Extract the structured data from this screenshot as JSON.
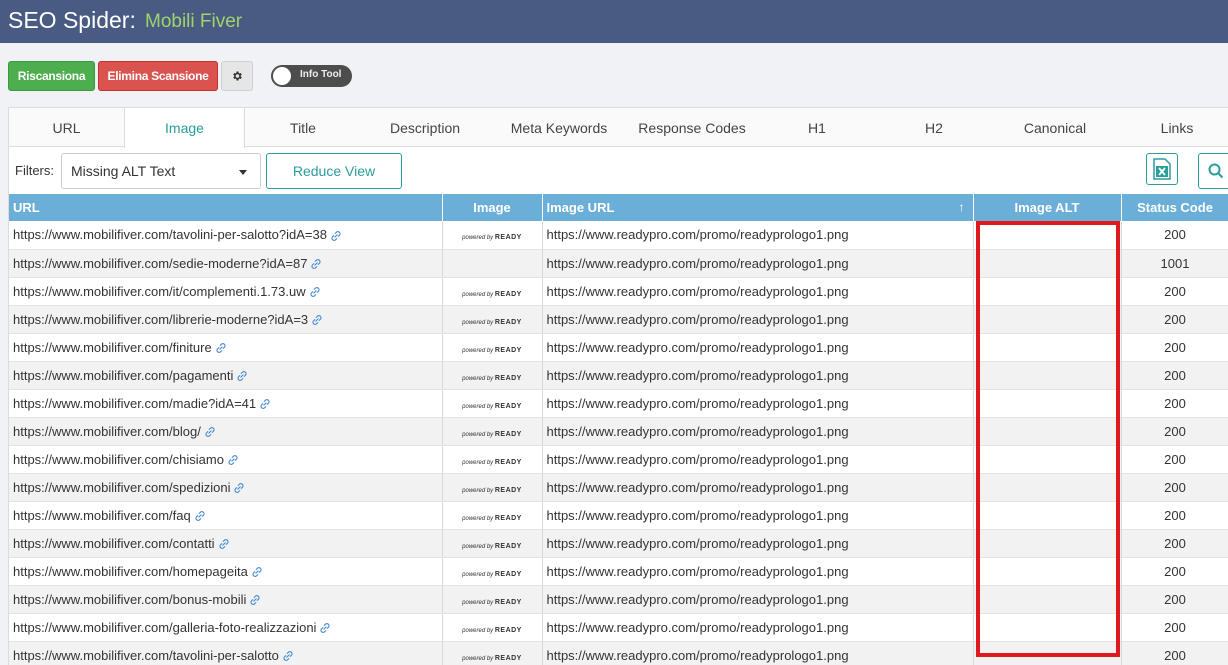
{
  "header": {
    "app_title": "SEO Spider:",
    "site_name": "Mobili Fiver"
  },
  "toolbar": {
    "rescan_label": "Riscansiona",
    "delete_label": "Elimina Scansione",
    "info_tool_label": "Info Tool"
  },
  "tabs": [
    {
      "label": "URL"
    },
    {
      "label": "Image"
    },
    {
      "label": "Title"
    },
    {
      "label": "Description"
    },
    {
      "label": "Meta Keywords"
    },
    {
      "label": "Response Codes"
    },
    {
      "label": "H1"
    },
    {
      "label": "H2"
    },
    {
      "label": "Canonical"
    },
    {
      "label": "Links"
    }
  ],
  "active_tab": "Image",
  "filters": {
    "label": "Filters:",
    "selected": "Missing ALT Text",
    "reduce_label": "Reduce View"
  },
  "table": {
    "headers": {
      "url": "URL",
      "image": "Image",
      "image_url": "Image URL",
      "image_alt": "Image ALT",
      "status": "Status Code"
    },
    "logo_text": {
      "small": "powered by",
      "brand": "READY"
    },
    "rows": [
      {
        "url": "https://www.mobilifiver.com/tavolini-per-salotto?idA=38",
        "image_url": "https://www.readypro.com/promo/readyprologo1.png",
        "alt": "",
        "status": "200",
        "has_image": true
      },
      {
        "url": "https://www.mobilifiver.com/sedie-moderne?idA=87",
        "image_url": "https://www.readypro.com/promo/readyprologo1.png",
        "alt": "",
        "status": "1001",
        "has_image": false
      },
      {
        "url": "https://www.mobilifiver.com/it/complementi.1.73.uw",
        "image_url": "https://www.readypro.com/promo/readyprologo1.png",
        "alt": "",
        "status": "200",
        "has_image": true
      },
      {
        "url": "https://www.mobilifiver.com/librerie-moderne?idA=3",
        "image_url": "https://www.readypro.com/promo/readyprologo1.png",
        "alt": "",
        "status": "200",
        "has_image": true
      },
      {
        "url": "https://www.mobilifiver.com/finiture",
        "image_url": "https://www.readypro.com/promo/readyprologo1.png",
        "alt": "",
        "status": "200",
        "has_image": true
      },
      {
        "url": "https://www.mobilifiver.com/pagamenti",
        "image_url": "https://www.readypro.com/promo/readyprologo1.png",
        "alt": "",
        "status": "200",
        "has_image": true
      },
      {
        "url": "https://www.mobilifiver.com/madie?idA=41",
        "image_url": "https://www.readypro.com/promo/readyprologo1.png",
        "alt": "",
        "status": "200",
        "has_image": true
      },
      {
        "url": "https://www.mobilifiver.com/blog/",
        "image_url": "https://www.readypro.com/promo/readyprologo1.png",
        "alt": "",
        "status": "200",
        "has_image": true
      },
      {
        "url": "https://www.mobilifiver.com/chisiamo",
        "image_url": "https://www.readypro.com/promo/readyprologo1.png",
        "alt": "",
        "status": "200",
        "has_image": true
      },
      {
        "url": "https://www.mobilifiver.com/spedizioni",
        "image_url": "https://www.readypro.com/promo/readyprologo1.png",
        "alt": "",
        "status": "200",
        "has_image": true
      },
      {
        "url": "https://www.mobilifiver.com/faq",
        "image_url": "https://www.readypro.com/promo/readyprologo1.png",
        "alt": "",
        "status": "200",
        "has_image": true
      },
      {
        "url": "https://www.mobilifiver.com/contatti",
        "image_url": "https://www.readypro.com/promo/readyprologo1.png",
        "alt": "",
        "status": "200",
        "has_image": true
      },
      {
        "url": "https://www.mobilifiver.com/homepageita",
        "image_url": "https://www.readypro.com/promo/readyprologo1.png",
        "alt": "",
        "status": "200",
        "has_image": true
      },
      {
        "url": "https://www.mobilifiver.com/bonus-mobili",
        "image_url": "https://www.readypro.com/promo/readyprologo1.png",
        "alt": "",
        "status": "200",
        "has_image": true
      },
      {
        "url": "https://www.mobilifiver.com/galleria-foto-realizzazioni",
        "image_url": "https://www.readypro.com/promo/readyprologo1.png",
        "alt": "",
        "status": "200",
        "has_image": true
      },
      {
        "url": "https://www.mobilifiver.com/tavolini-per-salotto",
        "image_url": "https://www.readypro.com/promo/readyprologo1.png",
        "alt": "",
        "status": "200",
        "has_image": true
      }
    ]
  },
  "colors": {
    "header_bg": "#4a5b83",
    "accent": "#2a9d9d",
    "table_header": "#6bafd9",
    "highlight": "#e0191f"
  }
}
